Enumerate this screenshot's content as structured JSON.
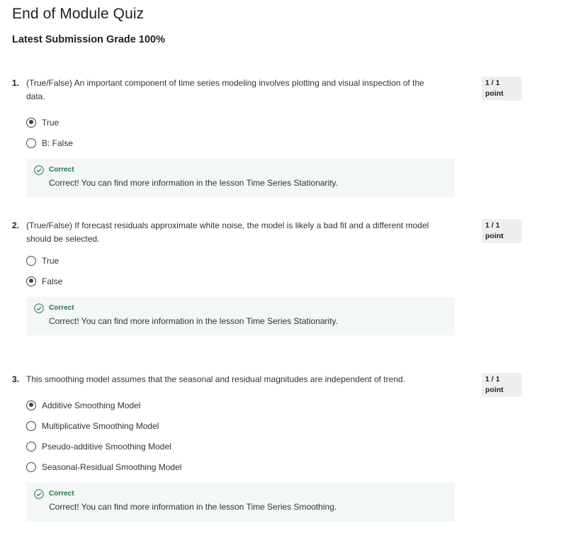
{
  "page": {
    "title": "End of Module Quiz",
    "grade": "Latest Submission Grade 100%"
  },
  "colors": {
    "correct_green": "#1f7a45",
    "feedback_bg": "#f3f7f6",
    "points_bg": "#eeeeee"
  },
  "questions": [
    {
      "number": "1.",
      "text": "(True/False) An important component of time series modeling involves plotting and visual inspection of the data.",
      "points": "1 / 1 point",
      "options": [
        {
          "label": "True",
          "selected": true
        },
        {
          "label": "B: False",
          "selected": false
        }
      ],
      "feedback": {
        "icon": "check-circle-icon",
        "status": "Correct",
        "text": "Correct! You can find more information in the lesson Time Series Stationarity."
      }
    },
    {
      "number": "2.",
      "text": "(True/False) If forecast residuals approximate white noise, the model is likely a bad fit and a different model should be selected.",
      "points": "1 / 1 point",
      "options": [
        {
          "label": "True",
          "selected": false
        },
        {
          "label": "False",
          "selected": true
        }
      ],
      "feedback": {
        "icon": "check-circle-icon",
        "status": "Correct",
        "text": "Correct! You can find more information in the lesson Time Series Stationarity."
      }
    },
    {
      "number": "3.",
      "text": "This smoothing model assumes that the seasonal and residual magnitudes are independent of trend.",
      "points": "1 / 1 point",
      "options": [
        {
          "label": "Additive Smoothing Model",
          "selected": true
        },
        {
          "label": "Multiplicative Smoothing Model",
          "selected": false
        },
        {
          "label": "Pseudo-additive Smoothing Model",
          "selected": false
        },
        {
          "label": "Seasonal-Residual Smoothing Model",
          "selected": false
        }
      ],
      "feedback": {
        "icon": "check-circle-icon",
        "status": "Correct",
        "text": "Correct! You can find more information in the lesson Time Series Smoothing."
      }
    }
  ]
}
